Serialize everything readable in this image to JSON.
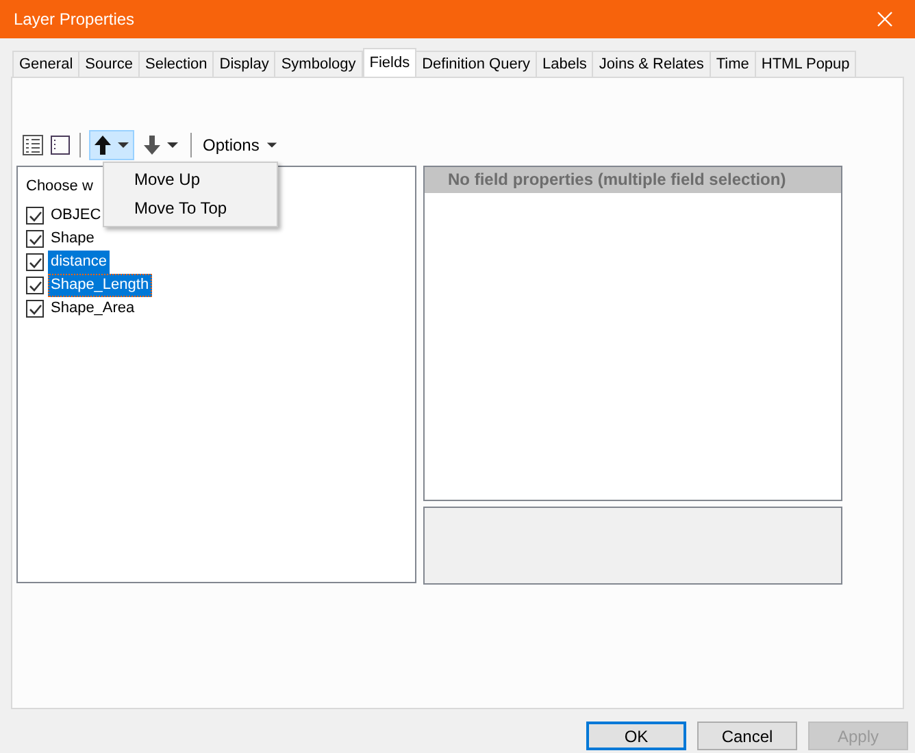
{
  "window": {
    "title": "Layer Properties"
  },
  "tabs": [
    {
      "label": "General",
      "selected": false
    },
    {
      "label": "Source",
      "selected": false
    },
    {
      "label": "Selection",
      "selected": false
    },
    {
      "label": "Display",
      "selected": false
    },
    {
      "label": "Symbology",
      "selected": false
    },
    {
      "label": "Fields",
      "selected": true
    },
    {
      "label": "Definition Query",
      "selected": false
    },
    {
      "label": "Labels",
      "selected": false
    },
    {
      "label": "Joins & Relates",
      "selected": false
    },
    {
      "label": "Time",
      "selected": false
    },
    {
      "label": "HTML Popup",
      "selected": false
    }
  ],
  "toolbar": {
    "options_label": "Options",
    "move_up_menu_open": true
  },
  "menu": [
    {
      "label": "Move Up"
    },
    {
      "label": "Move To Top"
    }
  ],
  "field_list": {
    "header": "Choose w",
    "items": [
      {
        "name": "OBJEC",
        "checked": true,
        "selected": false,
        "focused": false
      },
      {
        "name": "Shape",
        "checked": true,
        "selected": false,
        "focused": false
      },
      {
        "name": "distance",
        "checked": true,
        "selected": true,
        "focused": false
      },
      {
        "name": "Shape_Length",
        "checked": true,
        "selected": true,
        "focused": true
      },
      {
        "name": "Shape_Area",
        "checked": true,
        "selected": false,
        "focused": false
      }
    ]
  },
  "properties": {
    "header": "No field properties (multiple field selection)"
  },
  "buttons": [
    {
      "label": "OK",
      "default": true,
      "disabled": false
    },
    {
      "label": "Cancel",
      "default": false,
      "disabled": false
    },
    {
      "label": "Apply",
      "default": false,
      "disabled": true
    }
  ]
}
